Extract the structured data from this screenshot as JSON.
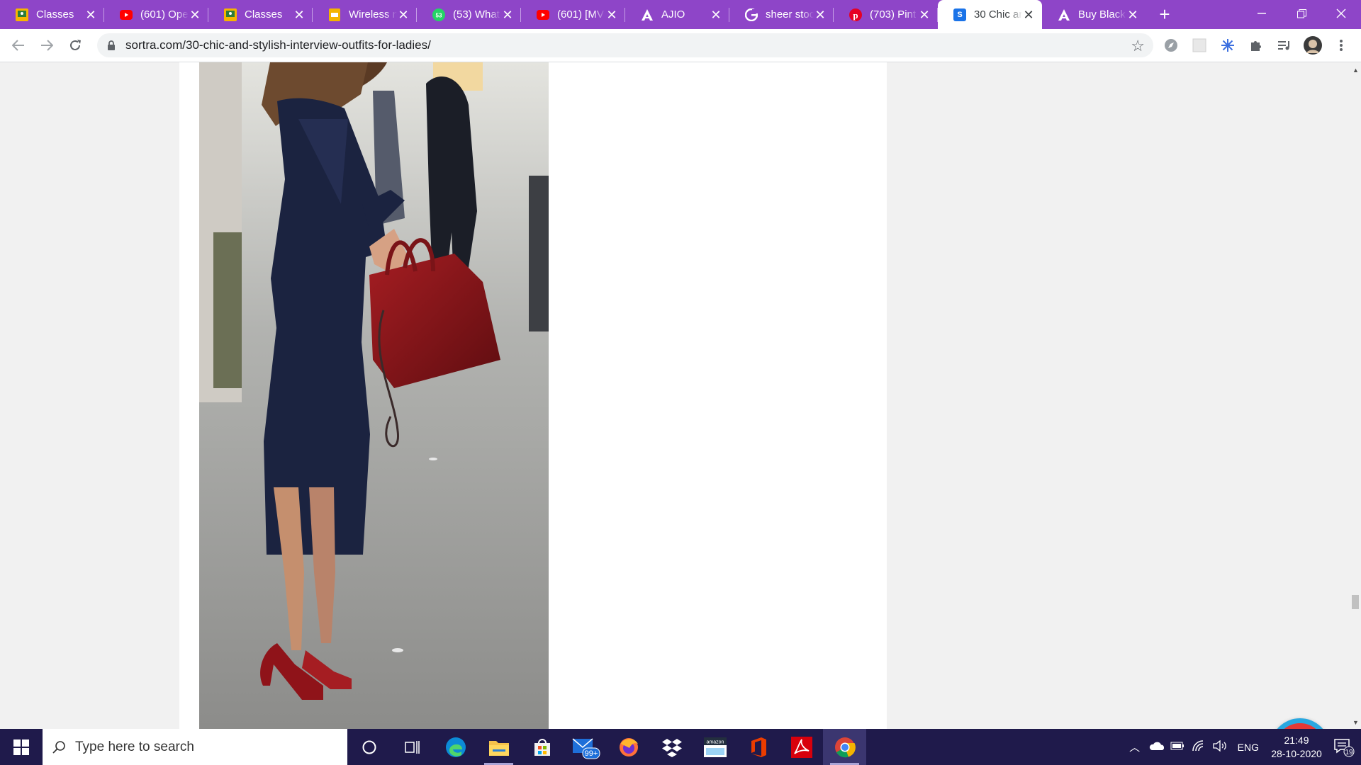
{
  "browser": {
    "tabs": [
      {
        "title": "Classes",
        "icon": "google-classroom-icon",
        "active": false
      },
      {
        "title": "(601) Ope",
        "icon": "youtube-icon",
        "active": false
      },
      {
        "title": "Classes",
        "icon": "google-classroom-icon",
        "active": false
      },
      {
        "title": "Wireless n",
        "icon": "google-slides-icon",
        "active": false
      },
      {
        "title": "(53) What",
        "icon": "whatsapp-icon",
        "active": false
      },
      {
        "title": "(601) [MV",
        "icon": "youtube-icon",
        "active": false
      },
      {
        "title": "AJIO",
        "icon": "ajio-icon",
        "active": false
      },
      {
        "title": "sheer stoc",
        "icon": "google-icon",
        "active": false
      },
      {
        "title": "(703) Pint",
        "icon": "pinterest-icon",
        "active": false
      },
      {
        "title": "30 Chic ar",
        "icon": "sortra-s-icon",
        "active": true
      },
      {
        "title": "Buy Black",
        "icon": "ajio-icon",
        "active": false
      }
    ],
    "new_tab": "+",
    "url": "sortra.com/30-chic-and-stylish-interview-outfits-for-ladies/",
    "favicon_s": "S",
    "whatsapp_count": "53"
  },
  "taskbar": {
    "search_placeholder": "Type here to search",
    "mail_badge": "99+",
    "amazon_label": "amazon",
    "tray_lang": "ENG",
    "time": "21:49",
    "date": "28-10-2020",
    "notifications_badge": "19"
  },
  "colors": {
    "tab_strip": "#8e45c8",
    "taskbar": "#1f1a4b",
    "bell_ring": "#29a8e0",
    "bell_fill": "#e53935"
  }
}
